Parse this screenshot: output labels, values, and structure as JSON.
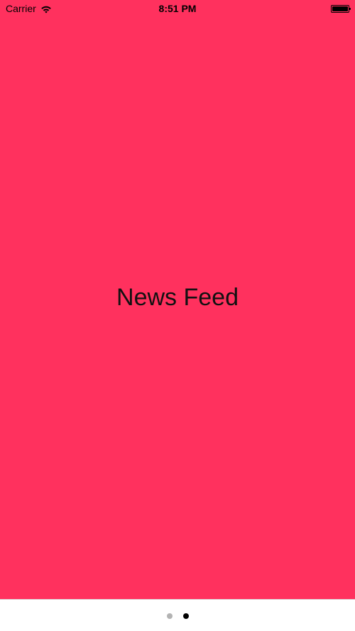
{
  "status_bar": {
    "carrier": "Carrier",
    "time": "8:51 PM",
    "wifi_icon": "wifi-icon",
    "battery_icon": "battery-icon"
  },
  "main": {
    "title": "News Feed",
    "background_color": "#ff315e"
  },
  "page_control": {
    "page_count": 2,
    "current_page": 2,
    "inactive_color": "#b3b3b3",
    "active_color": "#000000"
  }
}
